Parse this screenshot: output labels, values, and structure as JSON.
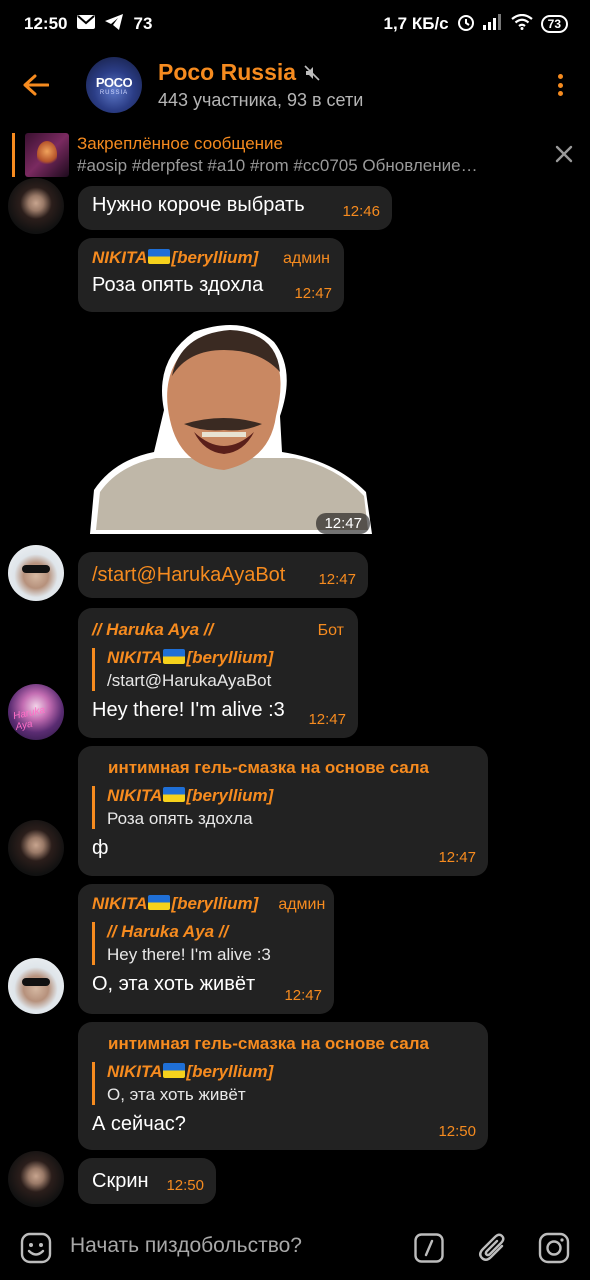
{
  "status_bar": {
    "time": "12:50",
    "notif_count": "73",
    "net_speed": "1,7 КБ/с",
    "battery": "73"
  },
  "header": {
    "title": "Poco Russia",
    "subtitle": "443 участника, 93 в сети",
    "avatar_line1": "POCO",
    "avatar_line2": "RUSSIA"
  },
  "pinned": {
    "title": "Закреплённое сообщение",
    "text": "#aosip #derpfest #a10 #rom #cc0705 Обновление…"
  },
  "messages": [
    {
      "text": "Нужно короче выбрать",
      "time": "12:46"
    },
    {
      "sender": "NIKITA",
      "sender_tag": "[beryllium]",
      "role": "админ",
      "text": "Роза опять здохла",
      "time": "12:47"
    },
    {
      "sticker_time": "12:47"
    },
    {
      "text": "/start@HarukaAyaBot",
      "time": "12:47"
    },
    {
      "sender": "// Haruka Aya //",
      "role": "Бот",
      "reply_name": "NIKITA",
      "reply_tag": "[beryllium]",
      "reply_text": "/start@HarukaAyaBot",
      "text": "Hey there! I'm alive :3",
      "time": "12:47"
    },
    {
      "sender": "интимная гель-смазка на основе сала",
      "reply_name": "NIKITA",
      "reply_tag": "[beryllium]",
      "reply_text": "Роза опять здохла",
      "text": "ф",
      "time": "12:47"
    },
    {
      "sender": "NIKITA",
      "sender_tag": "[beryllium]",
      "role": "админ",
      "reply_name": "// Haruka Aya //",
      "reply_text": "Hey there! I'm alive :3",
      "text": "О, эта хоть живёт",
      "time": "12:47"
    },
    {
      "sender": "интимная гель-смазка на основе сала",
      "reply_name": "NIKITA",
      "reply_tag": "[beryllium]",
      "reply_text": "О, эта хоть живёт",
      "text": "А сейчас?",
      "time": "12:50"
    },
    {
      "text": "Скрин",
      "time": "12:50"
    }
  ],
  "input": {
    "placeholder": "Начать пиздобольство?"
  },
  "avatar_labels": {
    "anime": "Haruka Aya"
  },
  "colors": {
    "accent": "#f68b1f",
    "bubble": "#222222",
    "background": "#000000"
  },
  "icons": [
    "back-arrow-icon",
    "mute-icon",
    "more-vert-icon",
    "close-icon",
    "emoji-icon",
    "bot-command-icon",
    "attach-icon",
    "camera-icon"
  ]
}
